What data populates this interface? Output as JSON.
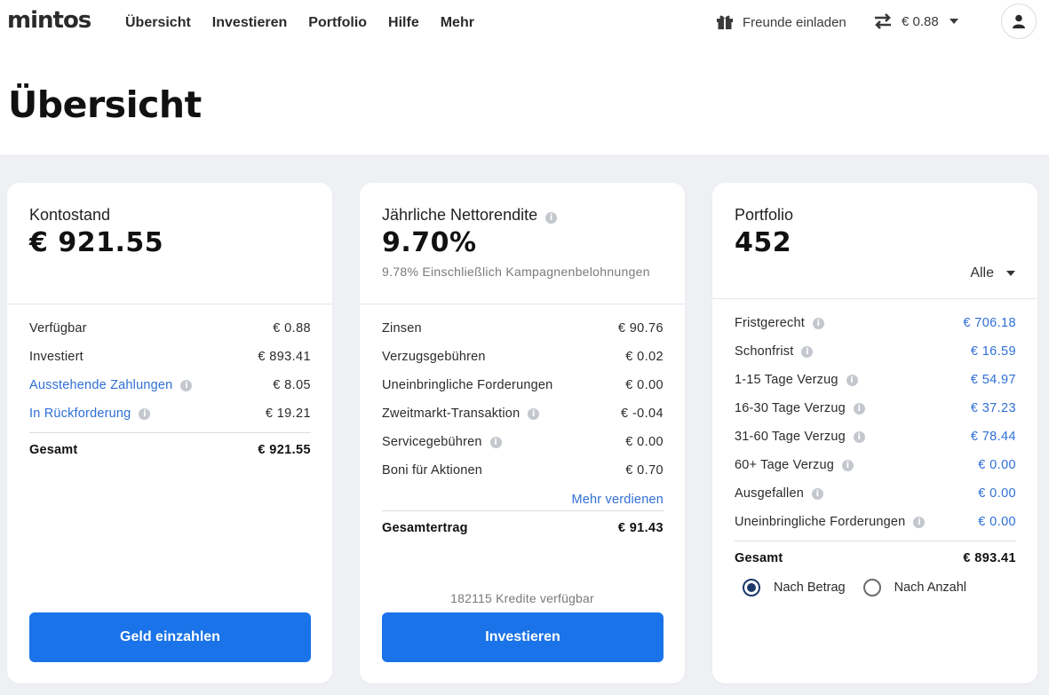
{
  "brand": {
    "logo_text": "mintos"
  },
  "nav": {
    "items": [
      "Übersicht",
      "Investieren",
      "Portfolio",
      "Hilfe",
      "Mehr"
    ]
  },
  "header": {
    "invite_label": "Freunde einladen",
    "balance": "€ 0.88"
  },
  "page": {
    "title": "Übersicht"
  },
  "account_card": {
    "title": "Kontostand",
    "amount": "€ 921.55",
    "rows": [
      {
        "label": "Verfügbar",
        "value": "€ 0.88"
      },
      {
        "label": "Investiert",
        "value": "€ 893.41"
      },
      {
        "label": "Ausstehende Zahlungen",
        "value": "€ 8.05"
      },
      {
        "label": "In Rückforderung",
        "value": "€ 19.21"
      }
    ],
    "total_label": "Gesamt",
    "total_value": "€ 921.55",
    "button_label": "Geld einzahlen"
  },
  "return_card": {
    "title": "Jährliche Nettorendite",
    "amount": "9.70%",
    "subtitle": "9.78% Einschließlich Kampagnenbelohnungen",
    "rows": [
      {
        "label": "Zinsen",
        "value": "€ 90.76"
      },
      {
        "label": "Verzugsgebühren",
        "value": "€ 0.02"
      },
      {
        "label": "Uneinbringliche Forderungen",
        "value": "€ 0.00"
      },
      {
        "label": "Zweitmarkt-Transaktion",
        "value": "€ -0.04"
      },
      {
        "label": "Servicegebühren",
        "value": "€ 0.00"
      },
      {
        "label": "Boni für Aktionen",
        "value": "€ 0.70"
      }
    ],
    "more_link": "Mehr verdienen",
    "total_label": "Gesamtertrag",
    "total_value": "€ 91.43",
    "credits_available": "182115 Kredite verfügbar",
    "button_label": "Investieren"
  },
  "portfolio_card": {
    "title": "Portfolio",
    "amount": "452",
    "filter": "Alle",
    "rows": [
      {
        "label": "Fristgerecht",
        "value": "€ 706.18"
      },
      {
        "label": "Schonfrist",
        "value": "€ 16.59"
      },
      {
        "label": "1-15 Tage Verzug",
        "value": "€ 54.97"
      },
      {
        "label": "16-30 Tage Verzug",
        "value": "€ 37.23"
      },
      {
        "label": "31-60 Tage Verzug",
        "value": "€ 78.44"
      },
      {
        "label": "60+ Tage Verzug",
        "value": "€ 0.00"
      },
      {
        "label": "Ausgefallen",
        "value": "€ 0.00"
      },
      {
        "label": "Uneinbringliche Forderungen",
        "value": "€ 0.00"
      }
    ],
    "total_label": "Gesamt",
    "total_value": "€ 893.41",
    "radio_options": [
      "Nach Betrag",
      "Nach Anzahl"
    ],
    "radio_selected": "Nach Betrag"
  },
  "colors": {
    "primary_button": "#1a73e8",
    "link": "#2f6fd6",
    "background": "#eef0f3"
  }
}
